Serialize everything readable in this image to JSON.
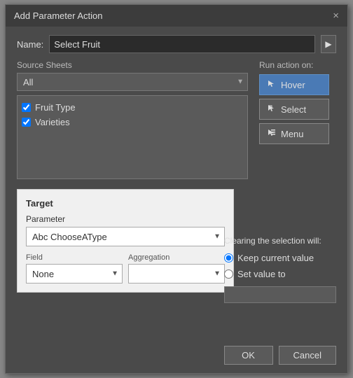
{
  "dialog": {
    "title": "Add Parameter Action",
    "close_icon": "×"
  },
  "name_row": {
    "label": "Name:",
    "value": "Select Fruit",
    "arrow": "▶"
  },
  "source_sheets": {
    "label": "Source Sheets",
    "dropdown": {
      "value": "All",
      "options": [
        "All"
      ]
    },
    "sheets": [
      {
        "label": "Fruit Type",
        "checked": true
      },
      {
        "label": "Varieties",
        "checked": true
      }
    ]
  },
  "run_action": {
    "label": "Run action on:",
    "buttons": [
      {
        "label": "Hover",
        "icon": "↖",
        "active": true
      },
      {
        "label": "Select",
        "icon": "↖",
        "active": false
      },
      {
        "label": "Menu",
        "icon": "↖",
        "active": false
      }
    ]
  },
  "target": {
    "title": "Target",
    "param_label": "Parameter",
    "param_value": "ChooseAType",
    "param_prefix": "Abc",
    "field_label": "Field",
    "field_value": "None",
    "agg_label": "Aggregation",
    "agg_placeholder": ""
  },
  "clearing": {
    "label": "Clearing the selection will:",
    "options": [
      {
        "label": "Keep current value",
        "checked": true
      },
      {
        "label": "Set value to",
        "checked": false
      }
    ],
    "set_value": ""
  },
  "footer": {
    "ok_label": "OK",
    "cancel_label": "Cancel"
  }
}
